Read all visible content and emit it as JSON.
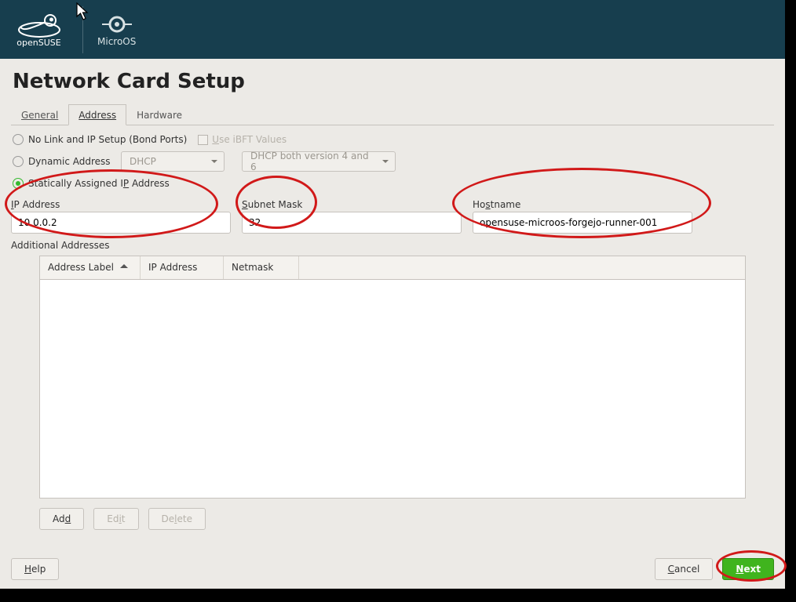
{
  "header": {
    "brand_text": "openSUSE",
    "product_text": "MicroOS"
  },
  "page": {
    "title": "Network Card Setup"
  },
  "tabs": {
    "general": "General",
    "address": "Address",
    "hardware": "Hardware"
  },
  "radios": {
    "no_link_label": "No Link and IP Setup (Bond Ports)",
    "use_ibft_label": "Use iBFT Values",
    "dynamic_label": "Dynamic Address",
    "dhcp_select": "DHCP",
    "dhcp_version_select": "DHCP both version 4 and 6",
    "static_label": "Statically Assigned IP Address"
  },
  "fields": {
    "ip_label": "IP Address",
    "ip_value": "10.0.0.2",
    "subnet_label": "Subnet Mask",
    "subnet_value": "32",
    "hostname_label": "Hostname",
    "hostname_value": "opensuse-microos-forgejo-runner-001"
  },
  "additional": "Additional Addresses",
  "table": {
    "col_label": "Address Label",
    "col_ip": "IP Address",
    "col_netmask": "Netmask"
  },
  "buttons": {
    "add": "Add",
    "edit": "Edit",
    "delete": "Delete",
    "help": "Help",
    "cancel": "Cancel",
    "next": "Next"
  }
}
